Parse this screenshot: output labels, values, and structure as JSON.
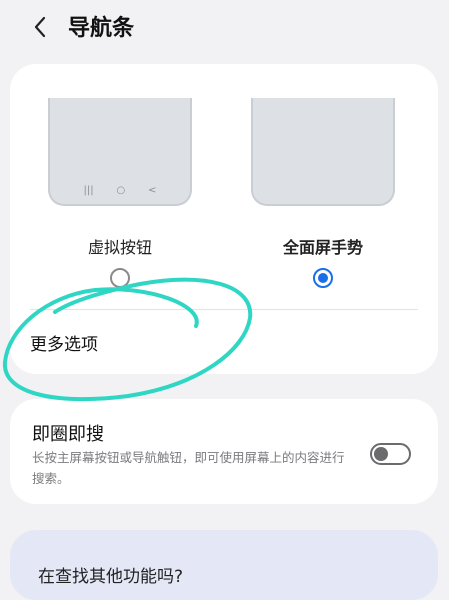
{
  "header": {
    "back_icon": "chevron-left-icon",
    "title": "导航条"
  },
  "nav_options": [
    {
      "label": "虚拟按钮",
      "selected": false,
      "preview_keys": [
        "|||",
        "○",
        "<"
      ]
    },
    {
      "label": "全面屏手势",
      "selected": true
    }
  ],
  "more_options_label": "更多选项",
  "circle_search": {
    "title": "即圈即搜",
    "description": "长按主屏幕按钮或导航触钮，即可使用屏幕上的内容进行搜索。",
    "enabled": false
  },
  "more_features": {
    "title": "在查找其他功能吗?"
  },
  "colors": {
    "accent": "#1a6fe8",
    "annotation": "#2fd6c4",
    "background": "#f2f2f4"
  }
}
